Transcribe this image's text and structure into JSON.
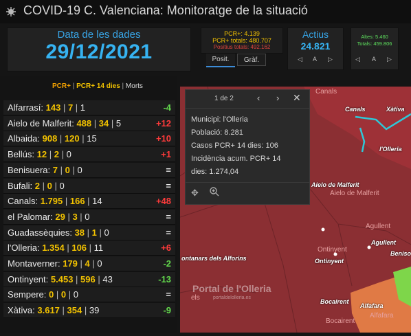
{
  "header": {
    "title": "COVID-19 C. Valenciana: Monitoratge de la situació",
    "logo_icon": "virus-icon"
  },
  "date_panel": {
    "label": "Data de les dades",
    "value": "29/12/2021"
  },
  "pcr_panel": {
    "line1": "PCR+: 4.139",
    "line2": "PCR+ totals: 480.707",
    "line3": "Positius totals: 492.162"
  },
  "tabs": {
    "posit": "Posit.",
    "graf": "Gràf."
  },
  "actius": {
    "label": "Actius",
    "value": "24.821",
    "nav_label": "A"
  },
  "altes": {
    "line1": "Altes: 5.460",
    "line2": "Totals: 459.806",
    "nav_label": "A"
  },
  "list_tabs": {
    "pcr": "PCR+",
    "pcr14": "PCR+ 14 dies",
    "deaths": "Morts",
    "separator": " | "
  },
  "rows": [
    {
      "name": "Alfarrasí:",
      "a": "143",
      "b": "7",
      "c": "1",
      "change": "-4",
      "dir": "down"
    },
    {
      "name": "Aielo de Malferit:",
      "a": "488",
      "b": "34",
      "c": "5",
      "change": "+12",
      "dir": "up"
    },
    {
      "name": "Albaida:",
      "a": "908",
      "b": "120",
      "c": "15",
      "change": "+10",
      "dir": "up"
    },
    {
      "name": "Bellús:",
      "a": "12",
      "b": "2",
      "c": "0",
      "change": "+1",
      "dir": "up"
    },
    {
      "name": "Benisuera:",
      "a": "7",
      "b": "0",
      "c": "0",
      "change": "=",
      "dir": "eq"
    },
    {
      "name": "Bufali:",
      "a": "2",
      "b": "0",
      "c": "0",
      "change": "=",
      "dir": "eq"
    },
    {
      "name": "Canals:",
      "a": "1.795",
      "b": "166",
      "c": "14",
      "change": "+48",
      "dir": "up"
    },
    {
      "name": "el Palomar:",
      "a": "29",
      "b": "3",
      "c": "0",
      "change": "=",
      "dir": "eq"
    },
    {
      "name": "Guadassèquies:",
      "a": "38",
      "b": "1",
      "c": "0",
      "change": "=",
      "dir": "eq"
    },
    {
      "name": "l'Olleria:",
      "a": "1.354",
      "b": "106",
      "c": "11",
      "change": "+6",
      "dir": "up"
    },
    {
      "name": "Montaverner:",
      "a": "179",
      "b": "4",
      "c": "0",
      "change": "-2",
      "dir": "down"
    },
    {
      "name": "Ontinyent:",
      "a": "5.453",
      "b": "596",
      "c": "43",
      "change": "-13",
      "dir": "down"
    },
    {
      "name": "Sempere:",
      "a": "0",
      "b": "0",
      "c": "0",
      "change": "=",
      "dir": "eq"
    },
    {
      "name": "Xàtiva:",
      "a": "3.617",
      "b": "354",
      "c": "39",
      "change": "-9",
      "dir": "down"
    }
  ],
  "popup": {
    "pager": "1 de 2",
    "lines": [
      "Municipi: l'Olleria",
      "Població: 8.281",
      "Casos PCR+ 14 dies: 106",
      "Incidència acum. PCR+ 14",
      "dies: 1.274,04"
    ]
  },
  "map": {
    "labels": {
      "canals_top": "Canals",
      "canals": "Canals",
      "xativa": "Xàtiva",
      "olleria": "l'Olleria",
      "aielo": "Aielo de Malferit",
      "aielo_dim": "Aielo de Malferit",
      "agullent": "Agullent",
      "agullent_dim": "Agullent",
      "benisoda": "Beniso",
      "ontinyent": "Ontinyent",
      "ontinyent_dim": "Ontinyent",
      "alforins": "ontanars dels Alforins",
      "bocairent": "Bocairent",
      "bocairent_dim": "Bocairent",
      "alfafara": "Alfafara",
      "alfafara_dim": "Alfafara",
      "dels": "els"
    },
    "watermark": "Portal de l'Olleria",
    "watermark_sub": "portaldelolleria.es",
    "colors": {
      "dark_red": "#8b2f33",
      "red": "#9e3137",
      "orange": "#e07a45",
      "green": "#7ed64a",
      "border": "#2ec8d8"
    }
  },
  "colors": {
    "accent": "#36b3f2",
    "value": "#f2c200",
    "up": "#ff3b3b",
    "down": "#62d84c"
  }
}
